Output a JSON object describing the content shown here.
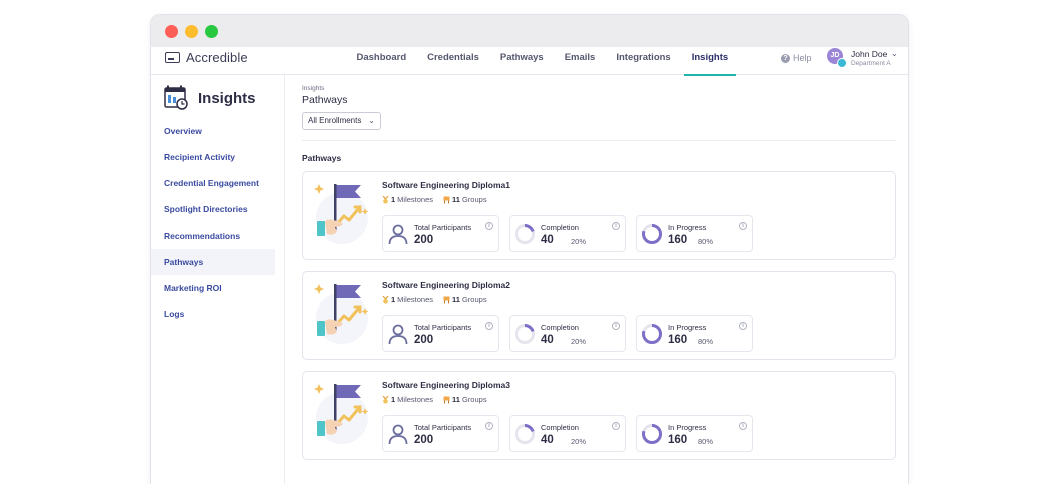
{
  "app": {
    "name": "Accredible"
  },
  "nav": {
    "tabs": [
      {
        "label": "Dashboard"
      },
      {
        "label": "Credentials"
      },
      {
        "label": "Pathways"
      },
      {
        "label": "Emails"
      },
      {
        "label": "Integrations"
      },
      {
        "label": "Insights",
        "active": true
      }
    ],
    "help_label": "Help",
    "user": {
      "initials": "JD",
      "name": "John Doe",
      "department": "Department A"
    }
  },
  "sidebar": {
    "title": "Insights",
    "items": [
      {
        "label": "Overview"
      },
      {
        "label": "Recipient Activity"
      },
      {
        "label": "Credential Engagement"
      },
      {
        "label": "Spotlight Directories"
      },
      {
        "label": "Recommendations"
      },
      {
        "label": "Pathways",
        "active": true
      },
      {
        "label": "Marketing ROI"
      },
      {
        "label": "Logs"
      }
    ]
  },
  "main": {
    "breadcrumb": "Insights",
    "title": "Pathways",
    "filter": {
      "selected": "All Enrollments"
    },
    "section_label": "Pathways",
    "cards": [
      {
        "title": "Software Engineering Diploma1",
        "milestones": "1",
        "milestones_label": "Milestones",
        "groups": "11",
        "groups_label": "Groups",
        "total_label": "Total Participants",
        "total": "200",
        "completion_label": "Completion",
        "completion": "40",
        "completion_pct": "20%",
        "completion_fraction": 0.2,
        "progress_label": "In Progress",
        "progress": "160",
        "progress_pct": "80%",
        "progress_fraction": 0.8
      },
      {
        "title": "Software Engineering Diploma2",
        "milestones": "1",
        "milestones_label": "Milestones",
        "groups": "11",
        "groups_label": "Groups",
        "total_label": "Total Participants",
        "total": "200",
        "completion_label": "Completion",
        "completion": "40",
        "completion_pct": "20%",
        "completion_fraction": 0.2,
        "progress_label": "In Progress",
        "progress": "160",
        "progress_pct": "80%",
        "progress_fraction": 0.8
      },
      {
        "title": "Software Engineering Diploma3",
        "milestones": "1",
        "milestones_label": "Milestones",
        "groups": "11",
        "groups_label": "Groups",
        "total_label": "Total Participants",
        "total": "200",
        "completion_label": "Completion",
        "completion": "40",
        "completion_pct": "20%",
        "completion_fraction": 0.2,
        "progress_label": "In Progress",
        "progress": "160",
        "progress_pct": "80%",
        "progress_fraction": 0.8
      }
    ]
  },
  "colors": {
    "accent_tab": "#1fb5ad",
    "nav_link": "#3a4aa0",
    "donut": "#7b6fc8",
    "donut_track": "#e4e4ec"
  }
}
